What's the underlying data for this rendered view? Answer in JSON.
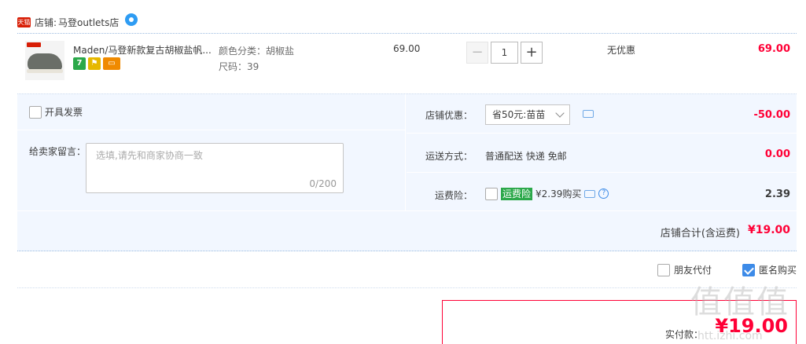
{
  "store": {
    "badge": "天猫",
    "label": "店铺:",
    "name": "马登outlets店"
  },
  "item": {
    "title": "Maden/马登新款复古胡椒盐帆...",
    "badge_seven": "7",
    "sku_color": "颜色分类：胡椒盐",
    "sku_size": "尺码：39",
    "unit_price": "69.00",
    "quantity": "1",
    "qty_minus": "−",
    "qty_plus": "+",
    "promo": "无优惠",
    "subtotal": "69.00"
  },
  "invoice": {
    "label": "开具发票",
    "checked": false
  },
  "message": {
    "label": "给卖家留言：",
    "placeholder": "选填,请先和商家协商一致",
    "counter": "0/200"
  },
  "store_coupon": {
    "label": "店铺优惠：",
    "selected": "省50元:苗苗",
    "amount": "-50.00"
  },
  "shipping": {
    "label": "运送方式：",
    "method": "普通配送 快递 免邮",
    "amount": "0.00"
  },
  "shipping_insurance": {
    "label": "运费险：",
    "tag": "运费险",
    "price_text": "¥2.39购买",
    "help": "?",
    "amount": "2.39"
  },
  "store_total": {
    "label": "店铺合计(含运费)",
    "amount": "¥19.00"
  },
  "options": {
    "friend_pay": "朋友代付",
    "anonymous": "匿名购买",
    "anonymous_checked": true
  },
  "payment": {
    "label": "实付款：",
    "amount": "¥19.00"
  },
  "watermark": {
    "logo": "值值值",
    "url": "htt.izhi.com"
  },
  "colors": {
    "accent_red": "#ff0036",
    "tmall_red": "#d81e06",
    "panel_bg": "#f2f7ff",
    "check_blue": "#3d8be8",
    "green": "#2ba84a"
  }
}
